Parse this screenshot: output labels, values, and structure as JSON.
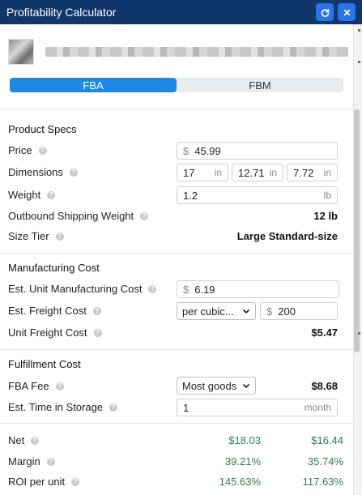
{
  "window": {
    "title": "Profitability Calculator"
  },
  "tabs": [
    {
      "label": "FBA",
      "active": true
    },
    {
      "label": "FBM",
      "active": false
    }
  ],
  "product_specs": {
    "heading": "Product Specs",
    "price_label": "Price",
    "price_prefix": "$",
    "price_value": "45.99",
    "dimensions_label": "Dimensions",
    "dimensions": [
      {
        "value": "17",
        "unit": "in"
      },
      {
        "value": "12.71",
        "unit": "in"
      },
      {
        "value": "7.72",
        "unit": "in"
      }
    ],
    "weight_label": "Weight",
    "weight_value": "1.2",
    "weight_unit": "lb",
    "outbound_label": "Outbound Shipping Weight",
    "outbound_value": "12 lb",
    "size_tier_label": "Size Tier",
    "size_tier_value": "Large Standard-size"
  },
  "manufacturing_cost": {
    "heading": "Manufacturing Cost",
    "unit_cost_label": "Est. Unit Manufacturing Cost",
    "unit_cost_prefix": "$",
    "unit_cost_value": "6.19",
    "freight_label": "Est. Freight Cost",
    "freight_select": "per cubic...",
    "freight_prefix": "$",
    "freight_value": "200",
    "unit_freight_label": "Unit Freight Cost",
    "unit_freight_value": "$5.47"
  },
  "fulfillment_cost": {
    "heading": "Fulfillment Cost",
    "fba_fee_label": "FBA Fee",
    "fba_fee_select": "Most goods",
    "fba_fee_value": "$8.68",
    "storage_label": "Est. Time in Storage",
    "storage_value": "1",
    "storage_unit": "month"
  },
  "summary": [
    {
      "label": "Net",
      "fba": "$18.03",
      "fbm": "$16.44"
    },
    {
      "label": "Margin",
      "fba": "39.21%",
      "fbm": "35.74%"
    },
    {
      "label": "ROI per unit",
      "fba": "145.63%",
      "fbm": "117.63%"
    }
  ],
  "colors": {
    "titlebar": "#11366b",
    "tab_active": "#1e88e5",
    "positive": "#2e7d4f"
  }
}
